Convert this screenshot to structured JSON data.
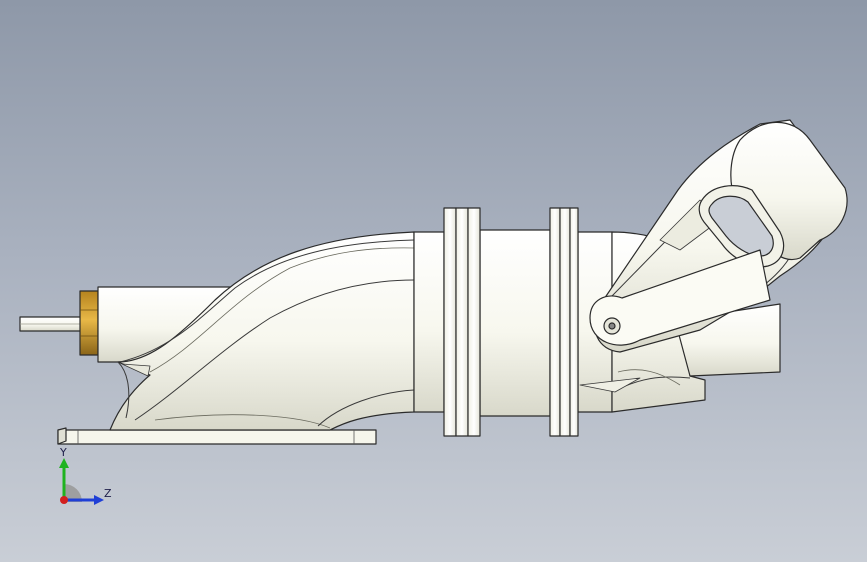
{
  "viewport": {
    "background_top": "#8e98a8",
    "background_bottom": "#c9ced6"
  },
  "model": {
    "body_color": "#fbfbf4",
    "shade_color": "#d9d9cc",
    "outline_color": "#2b2b2b",
    "fitting_color": "#c8962a",
    "fitting_shade": "#8a6418"
  },
  "triad": {
    "y_label": "Y",
    "z_label": "Z",
    "y_color": "#1fb31f",
    "z_color": "#1f3fd6",
    "x_color": "#d21f1f",
    "origin_icon": "axis-triad-icon"
  }
}
